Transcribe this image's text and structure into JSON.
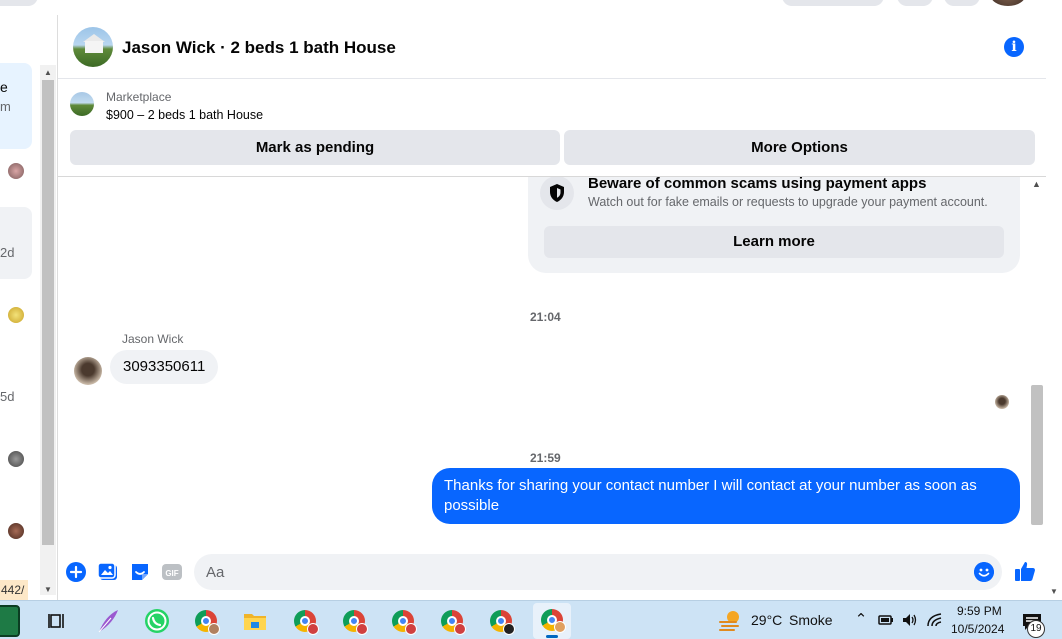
{
  "chat": {
    "title": "Jason Wick · 2 beds 1 bath House",
    "listing": {
      "label": "Marketplace",
      "price_title": "$900 – 2 beds 1 bath House"
    },
    "buttons": {
      "mark_pending": "Mark as pending",
      "more_options": "More Options"
    }
  },
  "scam_notice": {
    "title": "Beware of common scams using payment apps",
    "subtitle": "Watch out for fake emails or requests to upgrade your payment account.",
    "learn_more": "Learn more"
  },
  "messages": {
    "time1": "21:04",
    "sender_name": "Jason Wick",
    "incoming_text": "3093350611",
    "time2": "21:59",
    "outgoing_text": "Thanks for sharing your contact number I will contact at your number as soon as possible"
  },
  "composer": {
    "placeholder": "Aa"
  },
  "left_fragments": {
    "f1": "e",
    "f2": "m",
    "f3": "2d",
    "f4": "5d",
    "url_chip": "442/"
  },
  "taskbar": {
    "temperature": "29°C",
    "condition": "Smoke",
    "time": "9:59 PM",
    "date": "10/5/2024",
    "notification_count": "19"
  },
  "colors": {
    "accent": "#0866ff",
    "bubble_in": "#f0f2f5",
    "button_bg": "#e4e6eb",
    "taskbar_bg": "#cde3f5"
  }
}
